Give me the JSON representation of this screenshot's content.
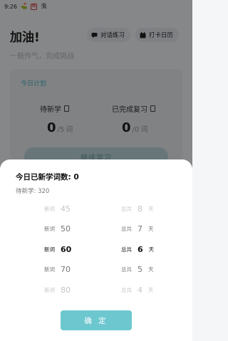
{
  "status_bar": {
    "time": "9:26",
    "icon1": "⛳",
    "icon2": "图",
    "icon3": "虫"
  },
  "header": {
    "title": "加油!",
    "subtitle": "一鼓作气，完成挑战"
  },
  "buttons": {
    "chat": "对话练习",
    "calendar": "打卡日历"
  },
  "plan": {
    "title": "今日计划",
    "left": {
      "label": "待新学",
      "value": "0",
      "total": "/5",
      "unit": "词"
    },
    "right": {
      "label": "已完成复习",
      "value": "0",
      "total": "/0",
      "unit": "词"
    },
    "continue": "继续学习"
  },
  "sheet": {
    "title": "今日已新学词数: 0",
    "subtitle": "待新学: 320",
    "new_words": [
      {
        "label": "新词",
        "value": "45"
      },
      {
        "label": "新词",
        "value": "50"
      },
      {
        "label": "新词",
        "value": "60"
      },
      {
        "label": "新词",
        "value": "70"
      },
      {
        "label": "新词",
        "value": "80"
      }
    ],
    "days": [
      {
        "label": "总共",
        "value": "8",
        "unit": "天"
      },
      {
        "label": "总共",
        "value": "7",
        "unit": "天"
      },
      {
        "label": "总共",
        "value": "6",
        "unit": "天"
      },
      {
        "label": "总共",
        "value": "5",
        "unit": "天"
      },
      {
        "label": "总共",
        "value": "4",
        "unit": "天"
      }
    ],
    "selected_new_words": "60",
    "selected_days": "6",
    "confirm": "确 定"
  },
  "colors": {
    "accent": "#6cc7cf",
    "plan_title": "#4fb3bf"
  },
  "icons": [
    "chat-icon",
    "calendar-icon",
    "doc-icon"
  ]
}
